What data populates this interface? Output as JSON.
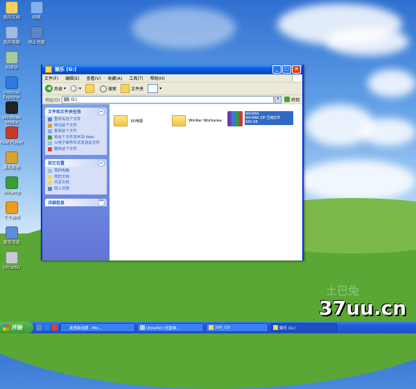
{
  "desktop": {
    "icons": [
      {
        "label": "我的文档",
        "name": "my-documents-icon",
        "color": "#f4d35e"
      },
      {
        "label": "我的电脑",
        "name": "my-computer-icon",
        "color": "#9fbbe3"
      },
      {
        "label": "回收站",
        "name": "recycle-bin-icon",
        "color": "#a8c8a0"
      },
      {
        "label": "Internet Explorer",
        "name": "internet-explorer-icon",
        "color": "#2d7be0"
      },
      {
        "label": "Windows Media Player",
        "name": "media-player-icon",
        "color": "#222"
      },
      {
        "label": "Real Player",
        "name": "realplayer-icon",
        "color": "#c83a2a"
      },
      {
        "label": "暴风影音",
        "name": "storm-player-icon",
        "color": "#d6a331"
      },
      {
        "label": "Winamp",
        "name": "winamp-icon",
        "color": "#3a9c34"
      },
      {
        "label": "千千静听",
        "name": "music-player-icon",
        "color": "#f29b1c"
      },
      {
        "label": "宽带连接",
        "name": "broadband-icon",
        "color": "#5c8ed8"
      },
      {
        "label": "UltraISO",
        "name": "ultraiso-icon",
        "color": "#c8c8d8"
      }
    ],
    "icons_col2": [
      {
        "label": "网络",
        "name": "network-icon",
        "color": "#7fb2f0"
      },
      {
        "label": "网上邻居",
        "name": "network-places-icon",
        "color": "#5a86c8"
      }
    ]
  },
  "window": {
    "title": "娱乐 (G:)",
    "menu": [
      "文件(F)",
      "编辑(E)",
      "查看(V)",
      "收藏(A)",
      "工具(T)",
      "帮助(H)"
    ],
    "toolbar": {
      "back": "后退",
      "search": "搜索",
      "folders": "文件夹"
    },
    "address": {
      "label": "地址(D)",
      "value": "G:\\",
      "go": "转到"
    },
    "tasks_title": "文件和文件夹任务",
    "tasks": [
      {
        "label": "重命名这个文件",
        "color": "#5a86c8"
      },
      {
        "label": "移动这个文件",
        "color": "#d6a331"
      },
      {
        "label": "复制这个文件",
        "color": "#7fb2f0"
      },
      {
        "label": "将这个文件发布到 Web",
        "color": "#3a9c34"
      },
      {
        "label": "以电子邮件形式发送此文件",
        "color": "#9fbbe3"
      },
      {
        "label": "删除这个文件",
        "color": "#d8442a"
      }
    ],
    "other_title": "其它位置",
    "other": [
      {
        "label": "我的电脑",
        "color": "#9fbbe3"
      },
      {
        "label": "我的文档",
        "color": "#f4d35e"
      },
      {
        "label": "共享文档",
        "color": "#f4d35e"
      },
      {
        "label": "网上邻居",
        "color": "#5a86c8"
      }
    ],
    "details_title": "详细信息",
    "files": [
      {
        "label": "3D电影"
      },
      {
        "label": "WinRar Workarea"
      },
      {
        "label": "WinRAR ZIP 压缩文件",
        "sub1": "WinRAR",
        "sub2": "580 KB"
      }
    ]
  },
  "taskbar": {
    "start": "开始",
    "buttons": [
      {
        "label": "发表新话题 - Mic...",
        "color": "#2d7be0"
      },
      {
        "label": "UltraISO (光盘映...",
        "color": "#c8c8d8"
      },
      {
        "label": "200_CD",
        "color": "#f4d35e"
      },
      {
        "label": "娱乐 (G:)",
        "color": "#f4d35e"
      }
    ]
  },
  "watermark": "37uu.cn",
  "watermark_faint": "土巴兔"
}
